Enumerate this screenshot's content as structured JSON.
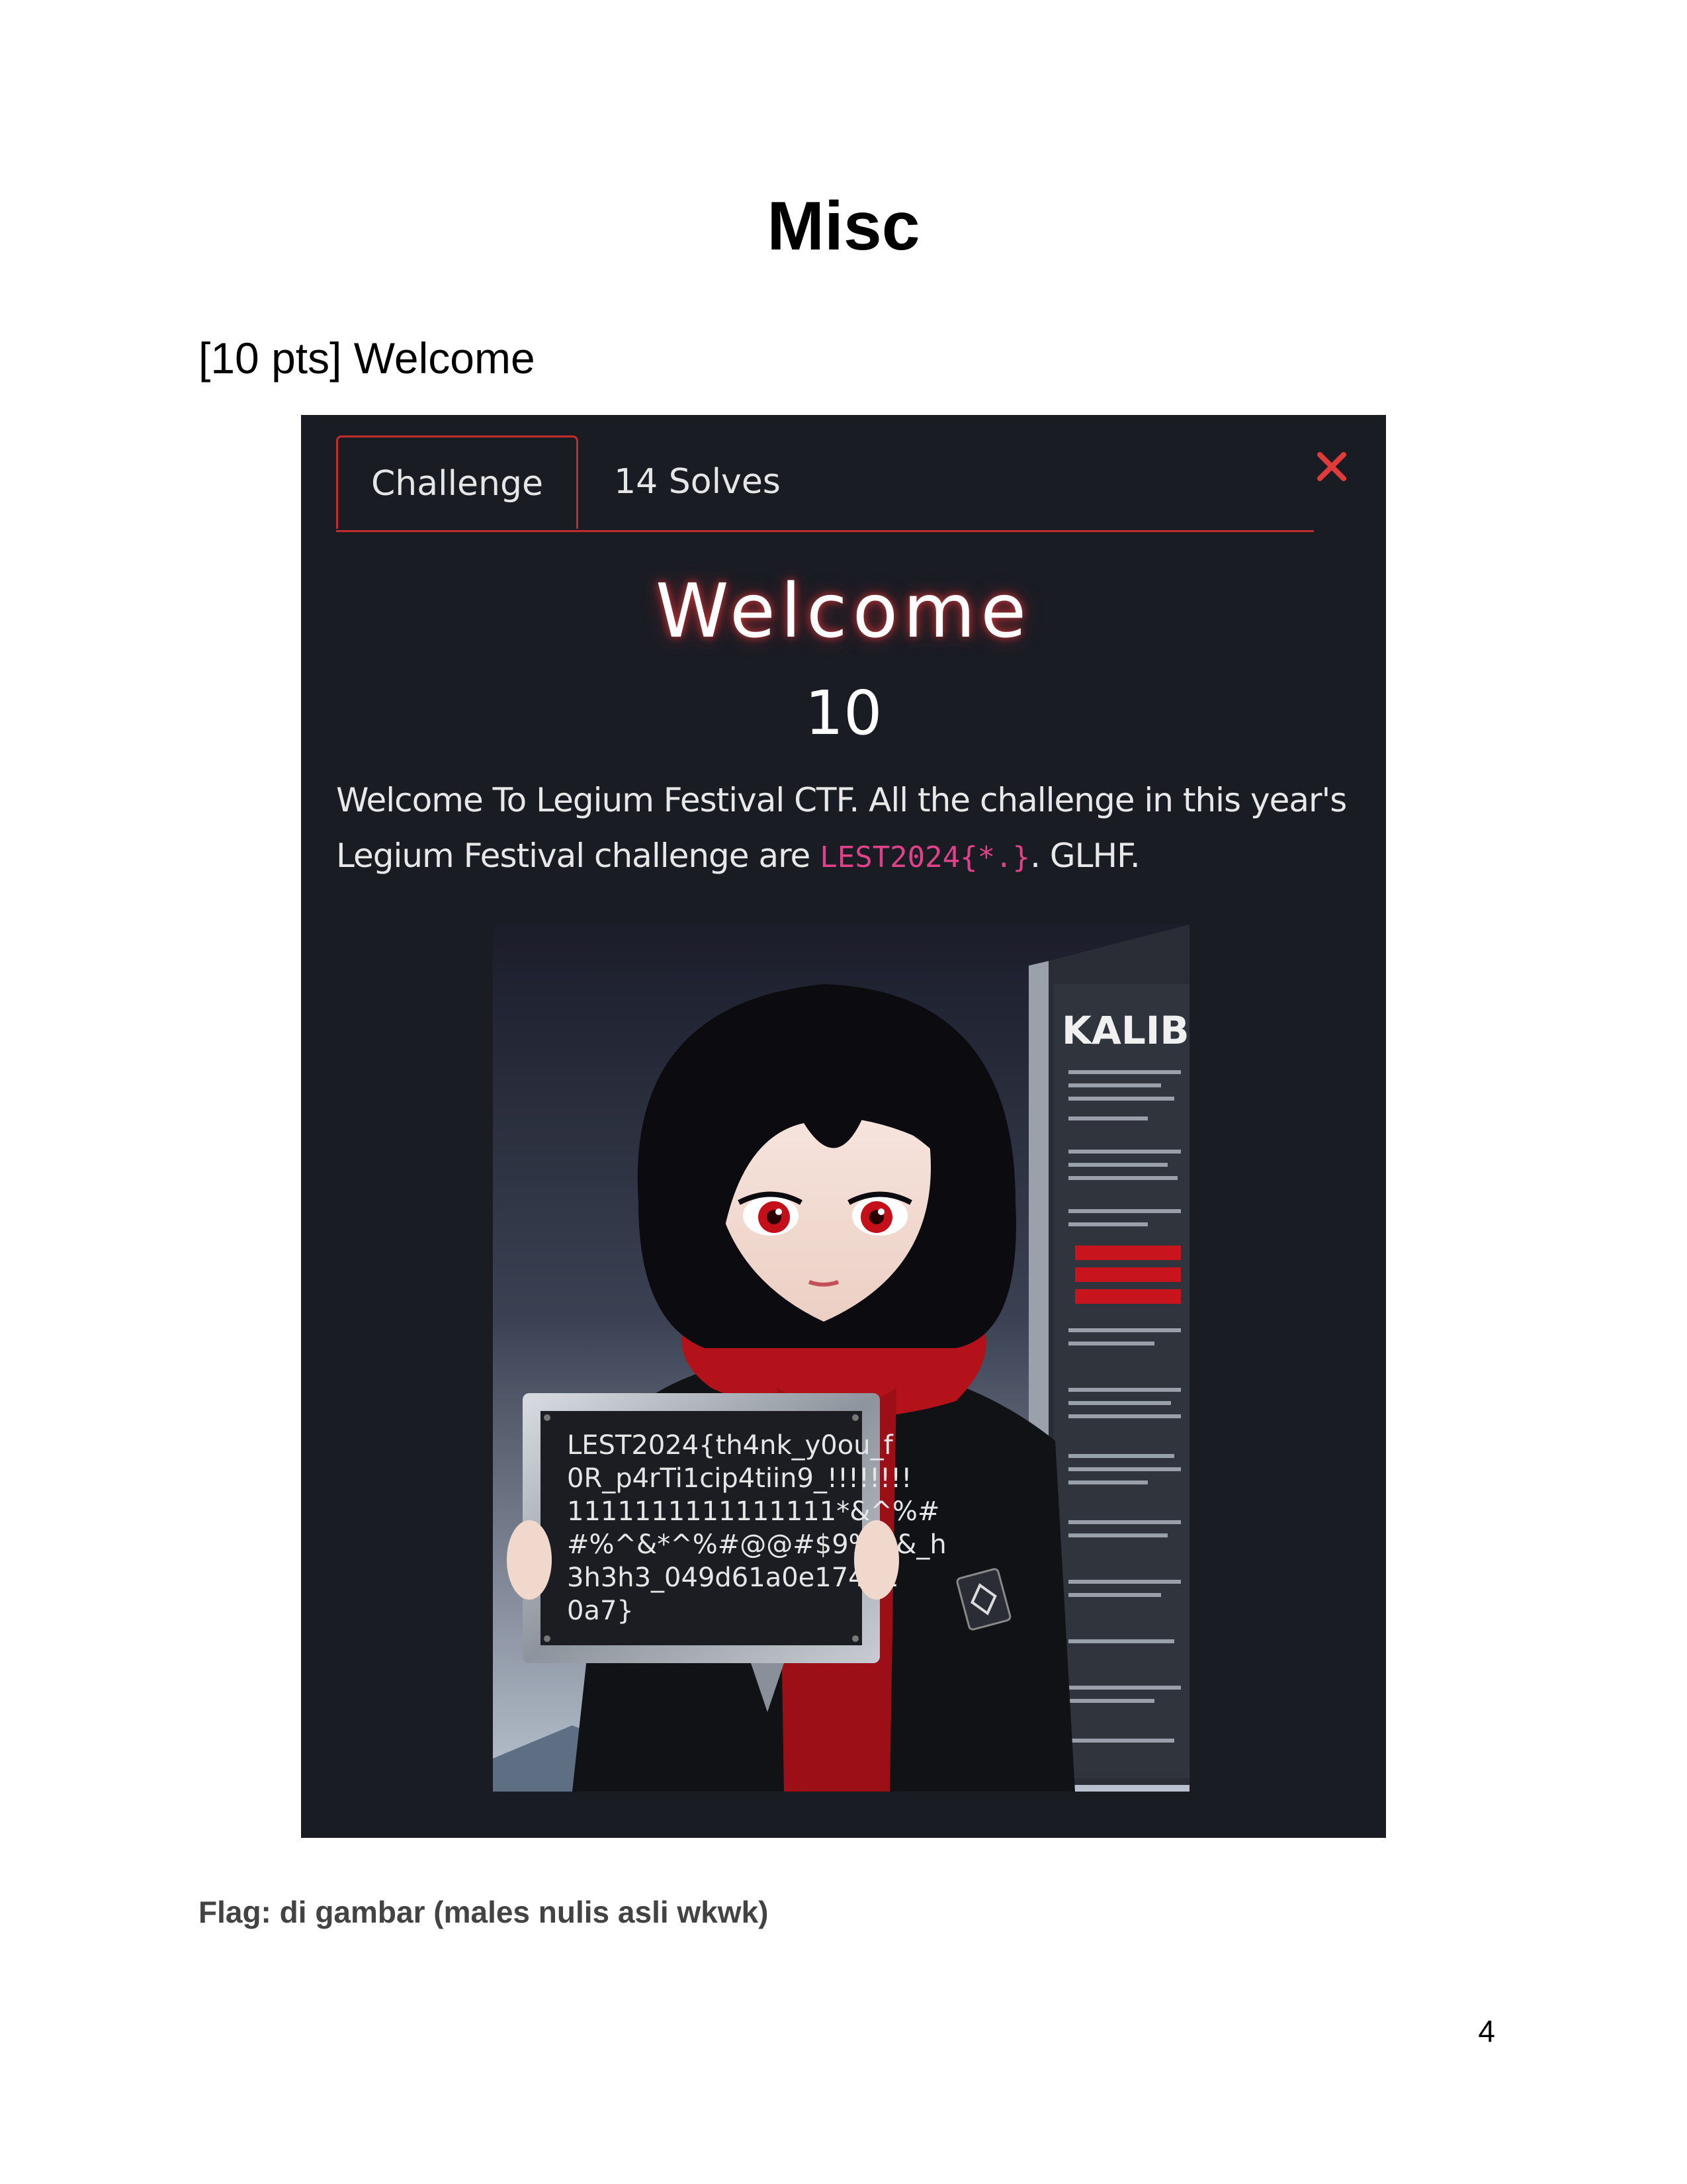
{
  "document": {
    "title": "Misc",
    "section_heading": "[10 pts] Welcome",
    "flag_line": "Flag: di gambar (males nulis asli wkwk)",
    "page_number": "4"
  },
  "screenshot": {
    "tabs": [
      {
        "label": "Challenge",
        "active": true
      },
      {
        "label": "14 Solves",
        "active": false
      }
    ],
    "close_icon": "close-x-icon",
    "challenge_name": "Welcome",
    "points": "10",
    "description_before": "Welcome To Legium Festival CTF. All the challenge in this year's Legium Festival challenge are ",
    "flag_format": "LEST2024{*.}",
    "description_after": ". GLHF.",
    "image": {
      "sign_lines": [
        "LEST2024{th4nk_y0ou_f",
        "0R_p4rTi1cip4tiin9_!!!!!!!!",
        "1111111111111111*&^%#",
        "#%^&*^%#@@#$9%^&_h",
        "3h3h3_049d61a0e17471",
        "0a7}"
      ],
      "banner_text": "KALIBER"
    },
    "colors": {
      "modal_bg": "#1a1c24",
      "accent_red": "#c42b2b",
      "code_pink": "#e0428a"
    }
  }
}
